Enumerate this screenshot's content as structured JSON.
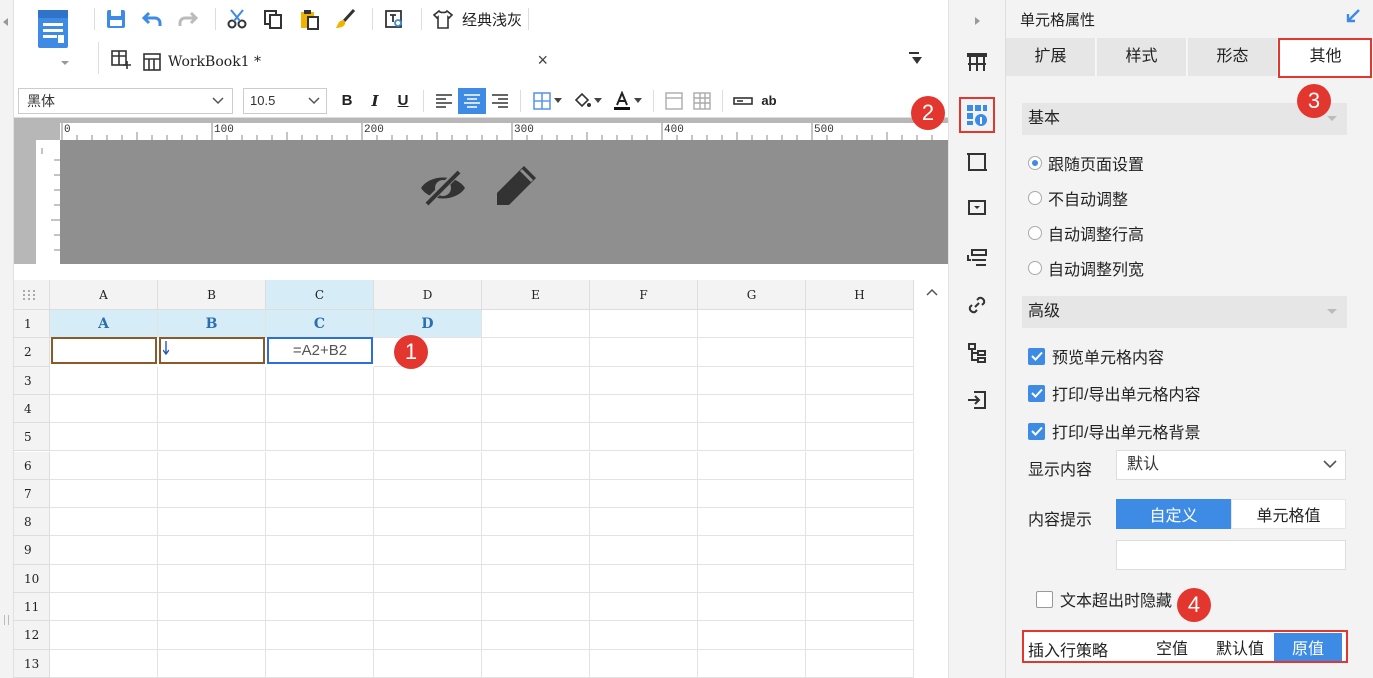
{
  "toolbar": {
    "theme_label": "经典浅灰"
  },
  "workbook_tab": {
    "title": "WorkBook1 *",
    "close": "×"
  },
  "format_bar": {
    "font_name": "黑体",
    "font_size": "10.5",
    "bold": "B",
    "italic": "I",
    "underline": "U",
    "text_style": "ab"
  },
  "ruler": {
    "marks": [
      "0",
      "100",
      "200",
      "300",
      "400",
      "500"
    ]
  },
  "sheet": {
    "columns": [
      "A",
      "B",
      "C",
      "D",
      "E",
      "F",
      "G",
      "H"
    ],
    "rows": [
      "1",
      "2",
      "3",
      "4",
      "5",
      "6",
      "7",
      "8",
      "9",
      "10",
      "11",
      "12",
      "13"
    ],
    "row1": [
      "A",
      "B",
      "C",
      "D"
    ],
    "formula_cell": "=A2+B2"
  },
  "panel": {
    "title": "单元格属性",
    "tabs": [
      "扩展",
      "样式",
      "形态",
      "其他"
    ],
    "section_basic": "基本",
    "radios": [
      "跟随页面设置",
      "不自动调整",
      "自动调整行高",
      "自动调整列宽"
    ],
    "section_advanced": "高级",
    "checks": [
      "预览单元格内容",
      "打印/导出单元格内容",
      "打印/导出单元格背景"
    ],
    "display_label": "显示内容",
    "display_value": "默认",
    "tip_label": "内容提示",
    "tip_options": [
      "自定义",
      "单元格值"
    ],
    "overflow_label": "文本超出时隐藏",
    "insert_label": "插入行策略",
    "insert_options": [
      "空值",
      "默认值",
      "原值"
    ]
  },
  "badges": [
    "1",
    "2",
    "3",
    "4"
  ],
  "colors": {
    "accent": "#3e8be5",
    "highlight": "#e2362f",
    "header_select": "#d6ecf7"
  }
}
